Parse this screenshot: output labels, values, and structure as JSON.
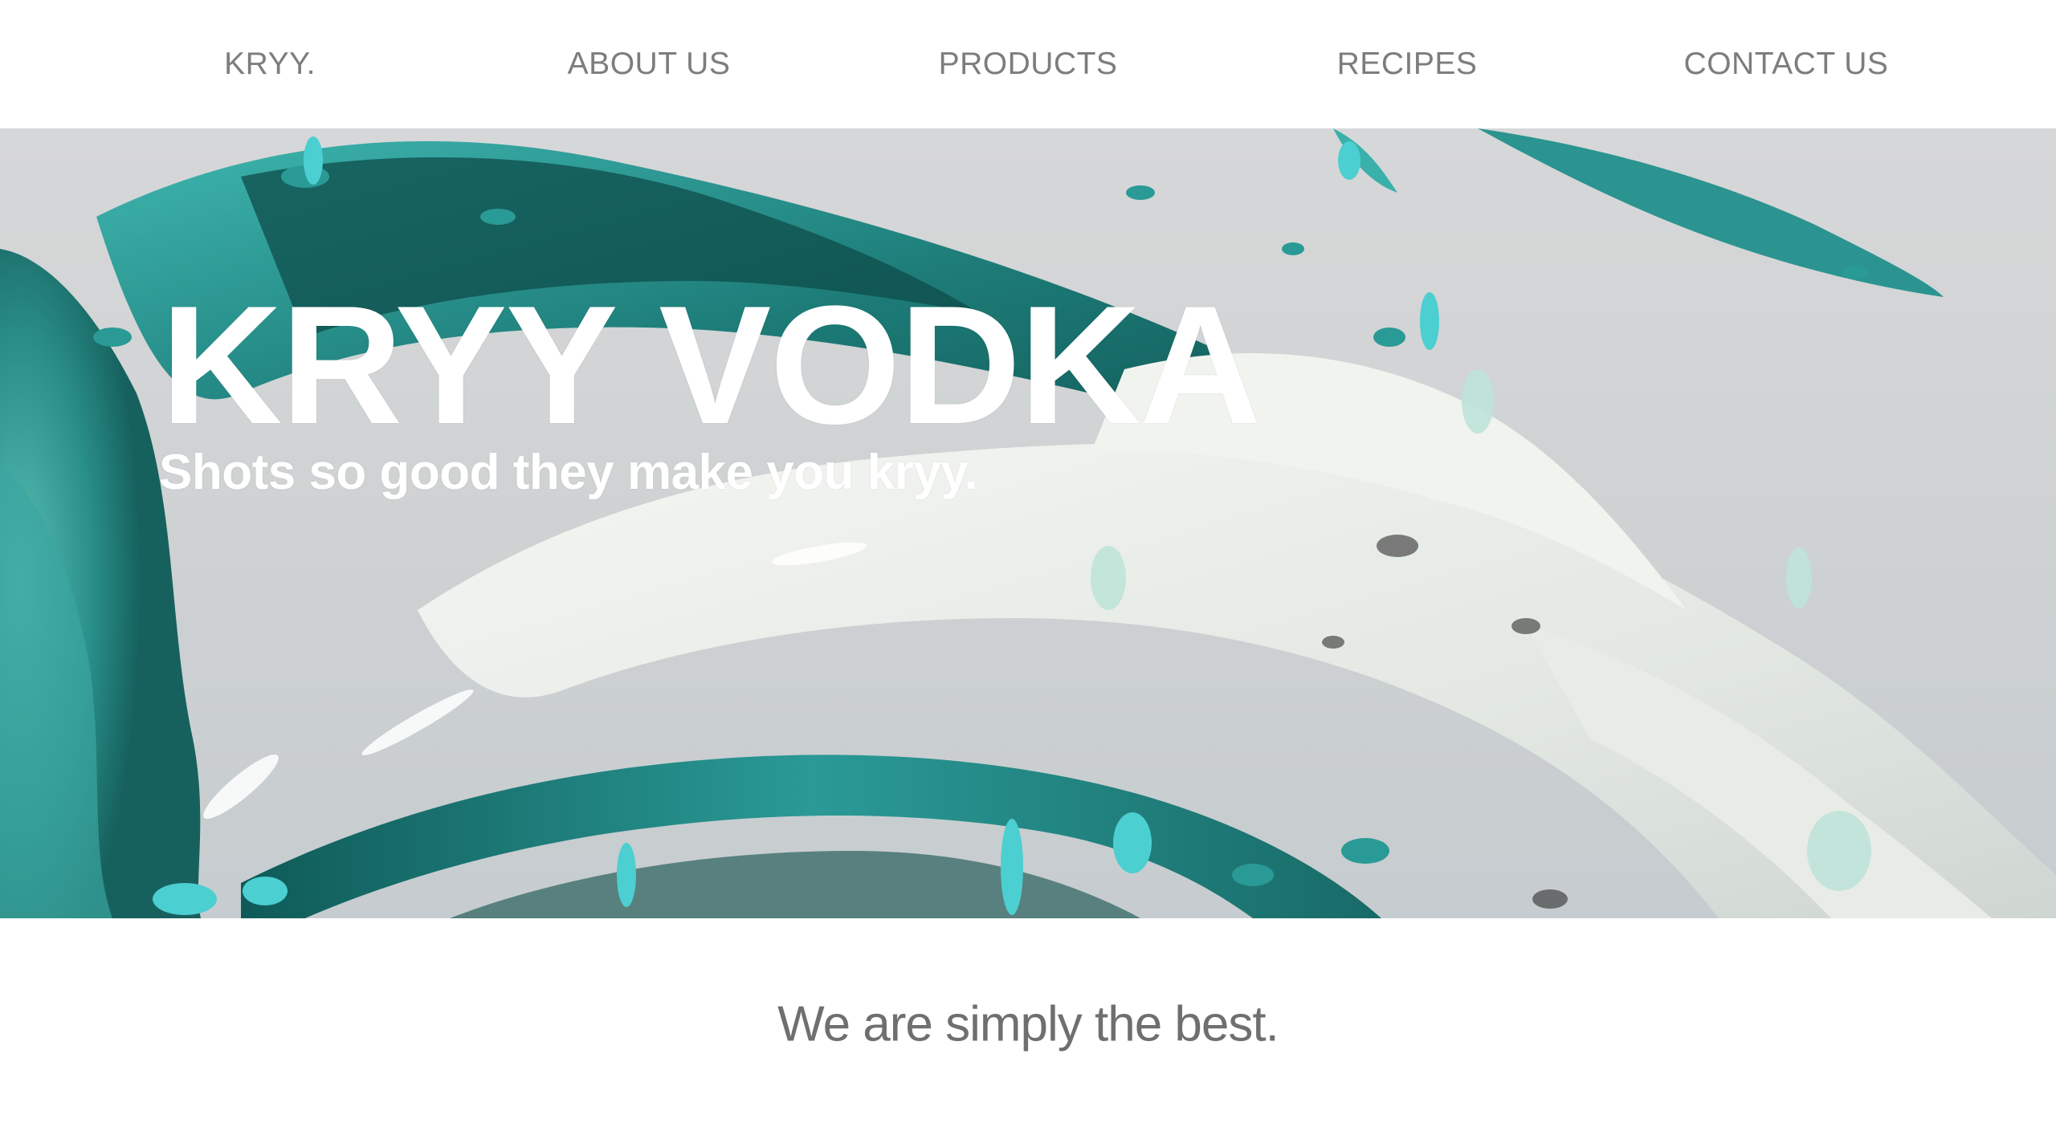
{
  "nav": {
    "brand": "KRYY.",
    "items": [
      {
        "label": "ABOUT US"
      },
      {
        "label": "PRODUCTS"
      },
      {
        "label": "RECIPES"
      },
      {
        "label": "CONTACT US"
      }
    ]
  },
  "hero": {
    "title": "KRYY VODKA",
    "subtitle": "Shots so good they make you kryy."
  },
  "tagline": "We are simply the best.",
  "colors": {
    "nav_text": "#7d7d7d",
    "teal": "#2a9a96",
    "dark_teal": "#0f5a58",
    "aqua": "#4ccfd0",
    "cream": "#ecefe9"
  }
}
